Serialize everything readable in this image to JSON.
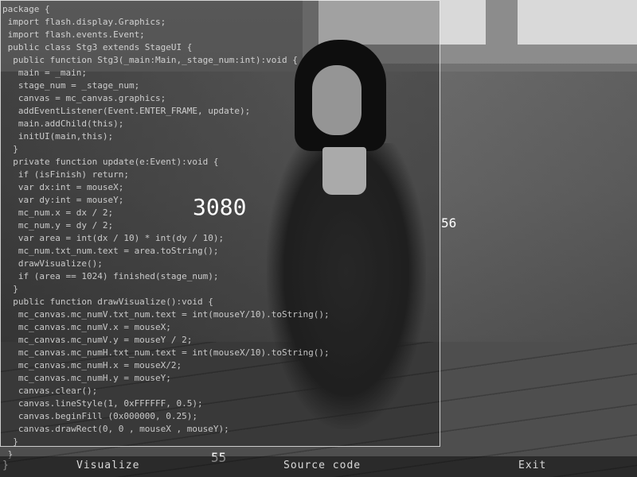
{
  "code_lines": [
    "package {",
    " import flash.display.Graphics;",
    " import flash.events.Event;",
    " public class Stg3 extends StageUI {",
    "  public function Stg3(_main:Main,_stage_num:int):void {",
    "   main = _main;",
    "   stage_num = _stage_num;",
    "   canvas = mc_canvas.graphics;",
    "   addEventListener(Event.ENTER_FRAME, update);",
    "   main.addChild(this);",
    "   initUI(main,this);",
    "  }",
    "  private function update(e:Event):void {",
    "   if (isFinish) return;",
    "   var dx:int = mouseX;",
    "   var dy:int = mouseY;",
    "   mc_num.x = dx / 2;",
    "   mc_num.y = dy / 2;",
    "   var area = int(dx / 10) * int(dy / 10);",
    "   mc_num.txt_num.text = area.toString();",
    "   drawVisualize();",
    "   if (area == 1024) finished(stage_num);",
    "  }",
    "  public function drawVisualize():void {",
    "   mc_canvas.mc_numV.txt_num.text = int(mouseY/10).toString();",
    "   mc_canvas.mc_numV.x = mouseX;",
    "   mc_canvas.mc_numV.y = mouseY / 2;",
    "   mc_canvas.mc_numH.txt_num.text = int(mouseX/10).toString();",
    "   mc_canvas.mc_numH.x = mouseX/2;",
    "   mc_canvas.mc_numH.y = mouseY;",
    "   canvas.clear();",
    "   canvas.lineStyle(1, 0xFFFFFF, 0.5);",
    "   canvas.beginFill (0x000000, 0.25);",
    "   canvas.drawRect(0, 0 , mouseX , mouseY);",
    "  }",
    " }"
  ],
  "area_value": "3080",
  "num_vertical": "56",
  "num_horizontal": "55",
  "menu": {
    "visualize": "Visualize",
    "source_code": "Source code",
    "exit": "Exit",
    "stray_brace": "}"
  },
  "colors": {
    "overlay_border": "#ffffff",
    "text": "#ffffff"
  }
}
